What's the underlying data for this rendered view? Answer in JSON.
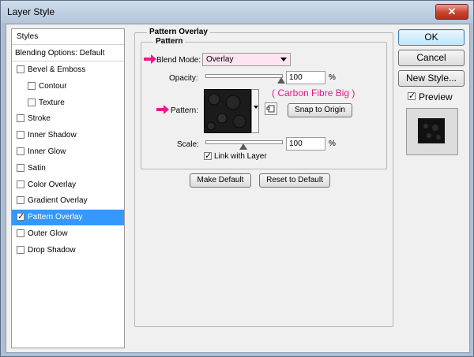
{
  "window": {
    "title": "Layer Style",
    "close_icon": "close-icon",
    "close_glyph": "✕"
  },
  "styles_list": {
    "header": "Styles",
    "blending": "Blending Options: Default",
    "items": [
      {
        "label": "Bevel & Emboss",
        "checked": false,
        "indent": false
      },
      {
        "label": "Contour",
        "checked": false,
        "indent": true
      },
      {
        "label": "Texture",
        "checked": false,
        "indent": true
      },
      {
        "label": "Stroke",
        "checked": false,
        "indent": false
      },
      {
        "label": "Inner Shadow",
        "checked": false,
        "indent": false
      },
      {
        "label": "Inner Glow",
        "checked": false,
        "indent": false
      },
      {
        "label": "Satin",
        "checked": false,
        "indent": false
      },
      {
        "label": "Color Overlay",
        "checked": false,
        "indent": false
      },
      {
        "label": "Gradient Overlay",
        "checked": false,
        "indent": false
      },
      {
        "label": "Pattern Overlay",
        "checked": true,
        "indent": false,
        "selected": true
      },
      {
        "label": "Outer Glow",
        "checked": false,
        "indent": false
      },
      {
        "label": "Drop Shadow",
        "checked": false,
        "indent": false
      }
    ]
  },
  "panel": {
    "title": "Pattern Overlay",
    "group_title": "Pattern",
    "blend_mode_label": "Blend Mode:",
    "blend_mode_value": "Overlay",
    "opacity_label": "Opacity:",
    "opacity_value": "100",
    "opacity_unit": "%",
    "opacity_level": 1.0,
    "pattern_label": "Pattern:",
    "pattern_annotation": "( Carbon Fibre Big )",
    "snap_button": "Snap to Origin",
    "scale_label": "Scale:",
    "scale_value": "100",
    "scale_unit": "%",
    "scale_level": 0.5,
    "link_label": "Link with Layer",
    "link_checked": true,
    "make_default": "Make Default",
    "reset_default": "Reset to Default",
    "accent_color": "#e8198b",
    "combo_color": "#fde4f0"
  },
  "actions": {
    "ok": "OK",
    "cancel": "Cancel",
    "new_style": "New Style...",
    "preview_label": "Preview",
    "preview_checked": true
  }
}
